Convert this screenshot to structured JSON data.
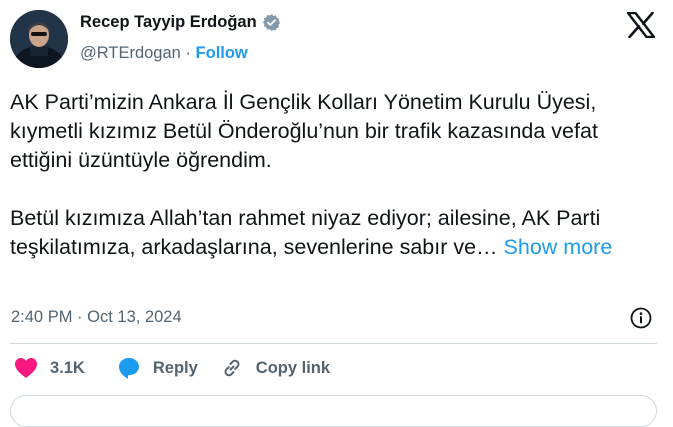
{
  "author": {
    "display_name": "Recep Tayyip Erdoğan",
    "handle": "@RTErdogan",
    "separator": "·",
    "follow_label": "Follow"
  },
  "tweet": {
    "paragraph1": "AK Parti’mizin Ankara İl Gençlik Kolları Yönetim Kurulu Üyesi, kıymetli kızımız Betül Önderoğlu’nun bir trafik kazasında vefat ettiğini üzüntüyle öğrendim.",
    "paragraph2": "Betül kızımıza Allah’tan rahmet niyaz ediyor; ailesine, AK Parti teşkilatımıza, arkadaşlarına, sevenlerine sabır ve…",
    "show_more_label": "Show more",
    "time": "2:40 PM",
    "dot": "·",
    "date": "Oct 13, 2024"
  },
  "actions": {
    "like_count": "3.1K",
    "reply_label": "Reply",
    "copy_link_label": "Copy link"
  },
  "colors": {
    "accent": "#1d9bf0",
    "like": "#f91880",
    "secondary_text": "#536471",
    "primary_text": "#0f1419",
    "verified_badge": "#829aab"
  },
  "icons": {
    "verified": "verified-badge-icon",
    "brand": "x-logo-icon",
    "info": "info-icon",
    "like": "heart-icon",
    "reply": "reply-bubble-icon",
    "copy_link": "link-icon"
  }
}
